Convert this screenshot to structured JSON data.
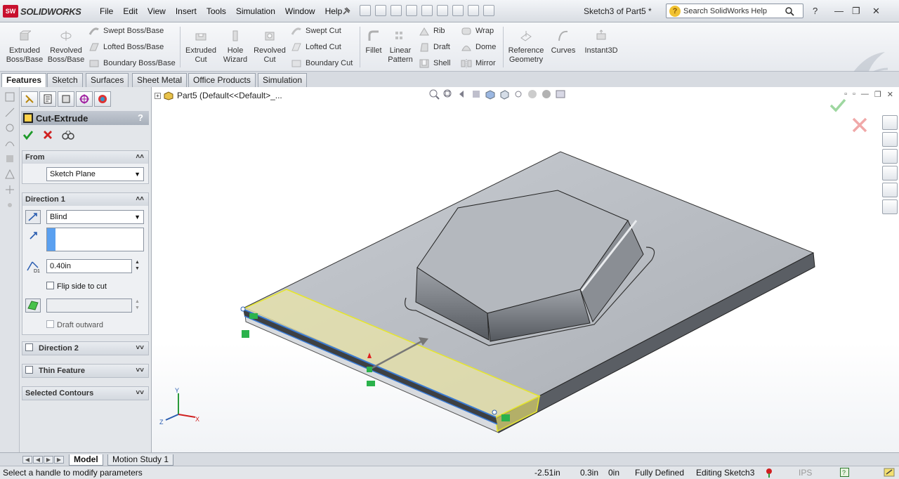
{
  "app": {
    "brand": "SOLIDWORKS",
    "brand_mark": "SW",
    "document_title": "Sketch3 of Part5 *"
  },
  "menu": [
    "File",
    "Edit",
    "View",
    "Insert",
    "Tools",
    "Simulation",
    "Window",
    "Help"
  ],
  "search": {
    "placeholder": "Search SolidWorks Help"
  },
  "command_manager": {
    "big": [
      {
        "label1": "Extruded",
        "label2": "Boss/Base"
      },
      {
        "label1": "Revolved",
        "label2": "Boss/Base"
      },
      {
        "label1": "Extruded",
        "label2": "Cut"
      },
      {
        "label1": "Hole",
        "label2": "Wizard"
      },
      {
        "label1": "Revolved",
        "label2": "Cut"
      },
      {
        "label1": "Fillet",
        "label2": ""
      },
      {
        "label1": "Linear",
        "label2": "Pattern"
      },
      {
        "label1": "Reference",
        "label2": "Geometry"
      },
      {
        "label1": "Curves",
        "label2": ""
      },
      {
        "label1": "Instant3D",
        "label2": ""
      }
    ],
    "small": [
      "Swept Boss/Base",
      "Lofted Boss/Base",
      "Boundary Boss/Base",
      "Swept Cut",
      "Lofted Cut",
      "Boundary Cut",
      "Rib",
      "Draft",
      "Shell",
      "Wrap",
      "Dome",
      "Mirror"
    ]
  },
  "tabs": [
    "Features",
    "Sketch",
    "Surfaces",
    "Sheet Metal",
    "Office Products",
    "Simulation"
  ],
  "property_manager": {
    "title": "Cut-Extrude",
    "help": "?",
    "from": {
      "header": "From",
      "value": "Sketch Plane"
    },
    "direction1": {
      "header": "Direction 1",
      "end_condition": "Blind",
      "depth": "0.40in",
      "flip_label": "Flip side to cut",
      "draft_label": "Draft outward"
    },
    "direction2": {
      "header": "Direction 2"
    },
    "thin": {
      "header": "Thin Feature"
    },
    "contours": {
      "header": "Selected Contours"
    }
  },
  "tree": {
    "part": "Part5",
    "config": "(Default<<Default>_..."
  },
  "bottom_tabs": [
    "Model",
    "Motion Study 1"
  ],
  "status": {
    "message": "Select a handle to modify parameters",
    "x": "-2.51in",
    "y": "0.3in",
    "z": "0in",
    "state": "Fully Defined",
    "editing": "Editing Sketch3",
    "units": "IPS"
  },
  "triad": {
    "x": "X",
    "y": "Y",
    "z": "Z"
  },
  "colors": {
    "brand_red": "#c8102e",
    "accent_blue": "#3a7bd5",
    "preview_yellow": "#eeee55",
    "confirm_green": "#1e9a2a",
    "cancel_red": "#d02020"
  }
}
